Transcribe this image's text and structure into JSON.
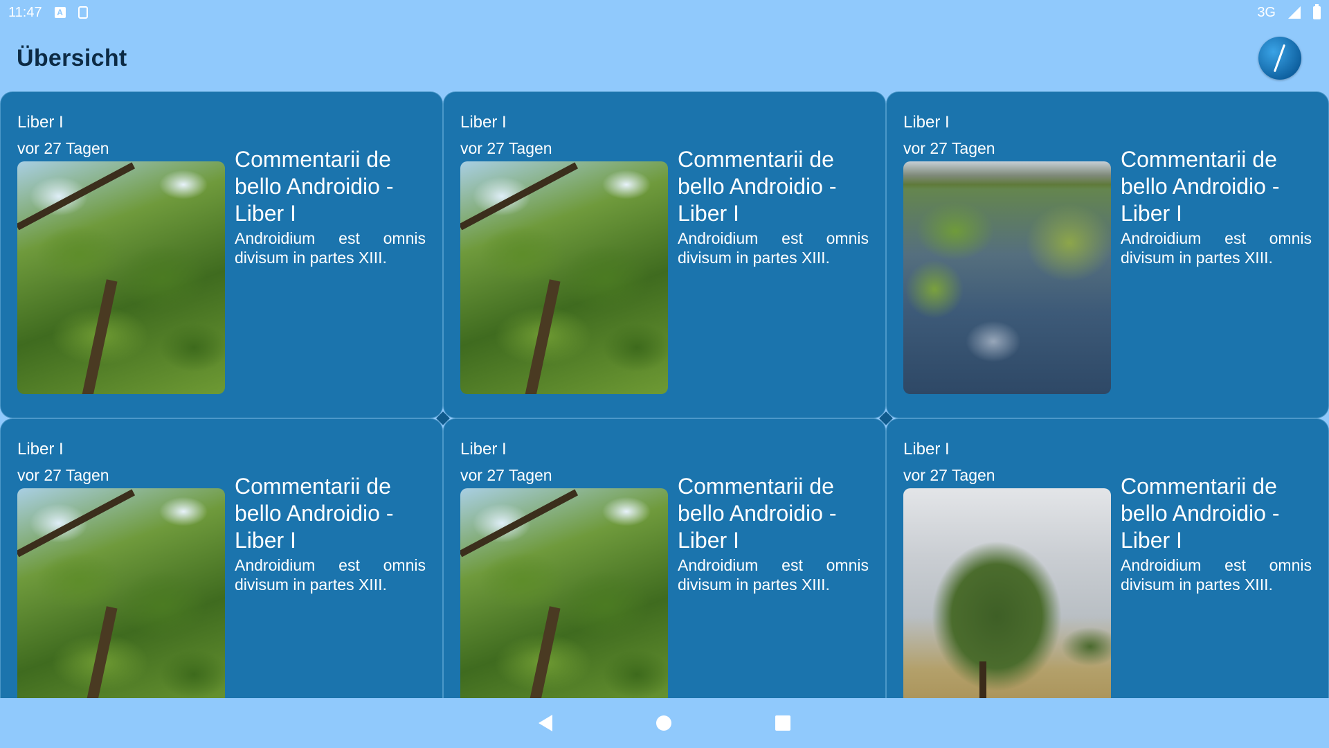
{
  "status_bar": {
    "time": "11:47",
    "network": "3G",
    "icons": [
      "a-notification-icon",
      "sd-card-icon",
      "signal-icon",
      "battery-icon"
    ]
  },
  "app_bar": {
    "title": "Übersicht",
    "logo_icon": "quill-logo-icon"
  },
  "cards": [
    {
      "category": "Liber I",
      "date": "vor 27 Tagen",
      "title": "Commentarii de bello Androidio - Liber I",
      "description": "Androidium est omnis divisum in partes XIII.",
      "image": "trees-canopy"
    },
    {
      "category": "Liber I",
      "date": "vor 27 Tagen",
      "title": "Commentarii de bello Androidio - Liber I",
      "description": "Androidium est omnis divisum in partes XIII.",
      "image": "trees-canopy"
    },
    {
      "category": "Liber I",
      "date": "vor 27 Tagen",
      "title": "Commentarii de bello Androidio - Liber I",
      "description": "Androidium est omnis divisum in partes XIII.",
      "image": "stream-grass"
    },
    {
      "category": "Liber I",
      "date": "vor 27 Tagen",
      "title": "Commentarii de bello Androidio - Liber I",
      "description": "Androidium est omnis divisum in partes XIII.",
      "image": "trees-canopy"
    },
    {
      "category": "Liber I",
      "date": "vor 27 Tagen",
      "title": "Commentarii de bello Androidio - Liber I",
      "description": "Androidium est omnis divisum in partes XIII.",
      "image": "trees-canopy"
    },
    {
      "category": "Liber I",
      "date": "vor 27 Tagen",
      "title": "Commentarii de bello Androidio - Liber I",
      "description": "Androidium est omnis divisum in partes XIII.",
      "image": "field-tree"
    }
  ],
  "nav_bar": {
    "icons": [
      "back-icon",
      "home-icon",
      "recents-icon"
    ]
  },
  "colors": {
    "background": "#90c9fc",
    "card": "#1b74ad",
    "title_text": "#0c2a44",
    "card_text": "#ffffff"
  }
}
